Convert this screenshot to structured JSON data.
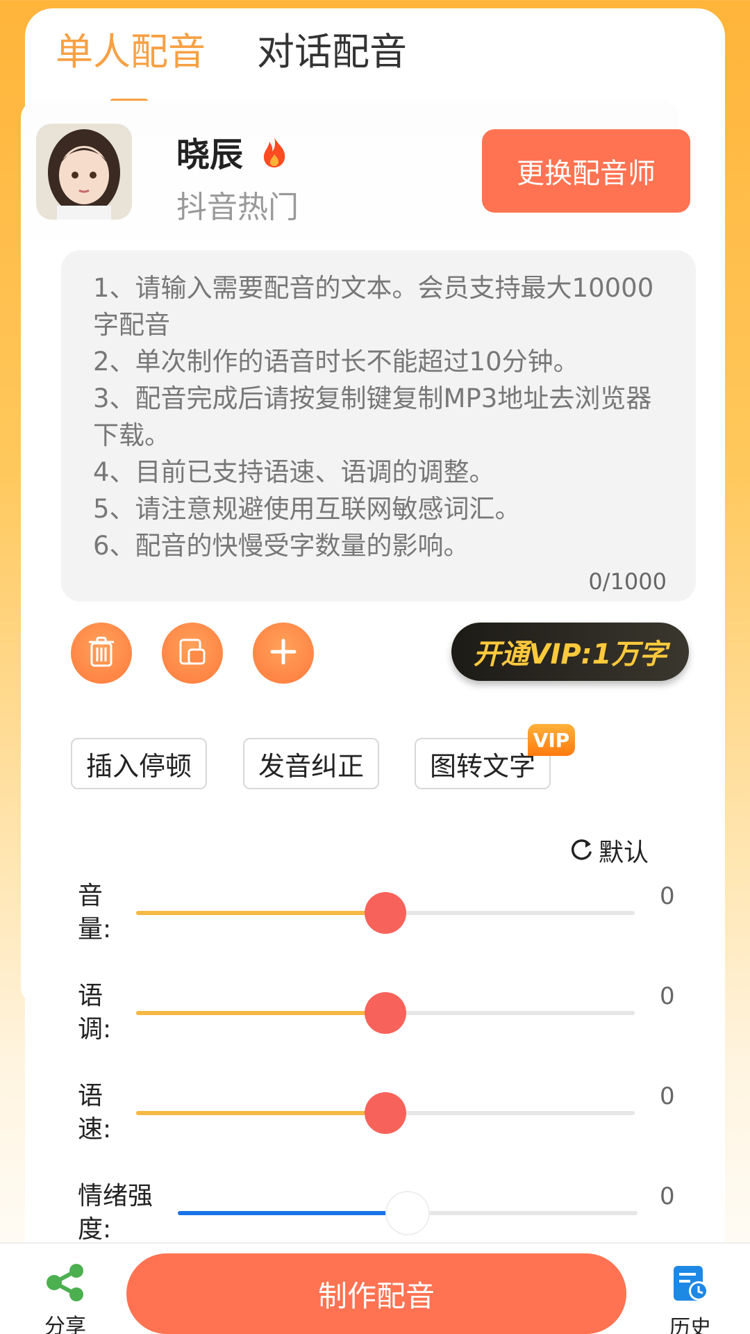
{
  "tabs": [
    {
      "label": "单人配音",
      "active": true
    },
    {
      "label": "对话配音",
      "active": false
    }
  ],
  "voice": {
    "name": "晓辰",
    "tag": "抖音热门",
    "change_label": "更换配音师"
  },
  "textbox": {
    "tips": "1、请输入需要配音的文本。会员支持最大10000字配音\n2、单次制作的语音时长不能超过10分钟。\n3、配音完成后请按复制键复制MP3地址去浏览器下载。\n4、目前已支持语速、语调的调整。\n5、请注意规避使用互联网敏感词汇。\n6、配音的快慢受字数量的影响。",
    "counter": "0/1000"
  },
  "actions": {
    "icons": [
      "trash-icon",
      "paste-icon",
      "plus-icon"
    ],
    "vip_label": "开通VIP:1万字"
  },
  "chips": [
    {
      "label": "插入停顿"
    },
    {
      "label": "发音纠正"
    },
    {
      "label": "图转文字"
    }
  ],
  "vip_badge": "VIP",
  "reset_label": "默认",
  "sliders": [
    {
      "label": "音\n量:",
      "value": "0",
      "level": 0.5,
      "color": "#f5b845",
      "thumb": "#f7635a"
    },
    {
      "label": "语\n调:",
      "value": "0",
      "level": 0.5,
      "color": "#f5b845",
      "thumb": "#f7635a"
    },
    {
      "label": "语\n速:",
      "value": "0",
      "level": 0.5,
      "color": "#f5b845",
      "thumb": "#f7635a"
    },
    {
      "label": "情绪强\n度:",
      "value": "0",
      "level": 0.5,
      "color": "#1a73e8",
      "thumb": "#ffffff"
    }
  ],
  "bottom": {
    "share_label": "分享",
    "make_label": "制作配音",
    "history_label": "历史"
  },
  "colors": {
    "accent": "#f7a043",
    "button": "#ff7352",
    "vip_text": "#ffc93c"
  }
}
